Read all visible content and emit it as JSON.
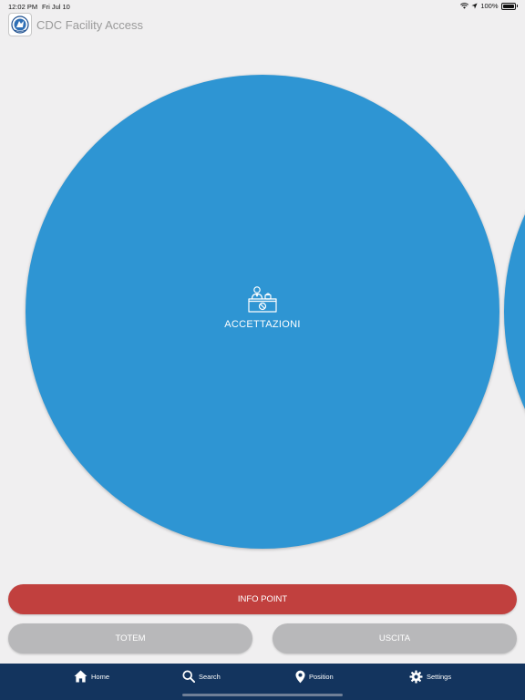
{
  "status_bar": {
    "time": "12:02 PM",
    "date": "Fri Jul 10",
    "battery": "100%",
    "icons": [
      "wifi-icon",
      "location-arrow-icon",
      "battery-icon"
    ]
  },
  "header": {
    "title": "CDC Facility Access",
    "logo_icon": "cdc-logo"
  },
  "carousel": {
    "current": {
      "label": "ACCETTAZIONI",
      "icon": "reception-desk-icon"
    },
    "color": "#2e95d3"
  },
  "buttons": {
    "info_point": "INFO POINT",
    "totem": "TOTEM",
    "uscita": "USCITA"
  },
  "tab_bar": {
    "items": [
      {
        "label": "Home",
        "icon": "home-icon"
      },
      {
        "label": "Search",
        "icon": "search-icon"
      },
      {
        "label": "Position",
        "icon": "map-pin-icon"
      },
      {
        "label": "Settings",
        "icon": "gear-icon"
      }
    ]
  },
  "colors": {
    "background": "#f0eff0",
    "circle": "#2e95d3",
    "info_point": "#c1403e",
    "secondary_button": "#b8b8ba",
    "tab_bar": "#13345e"
  }
}
